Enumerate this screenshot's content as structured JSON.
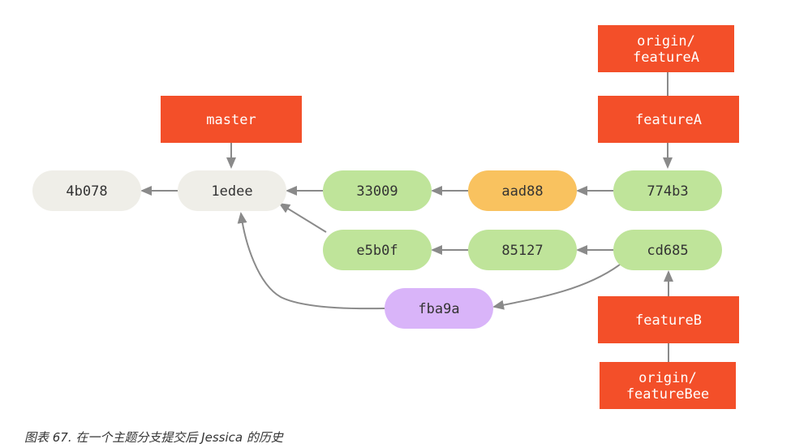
{
  "colors": {
    "branch": "#F34F29",
    "branch_text": "#ffffff",
    "commit_default": "#EFEEE8",
    "commit_green": "#BFE49A",
    "commit_orange": "#F9C25F",
    "commit_purple": "#D9B4F9",
    "commit_text": "#333333",
    "arrow": "#8A8A8A"
  },
  "commits": [
    {
      "id": "c-4b078",
      "label": "4b078",
      "color": "commit_default"
    },
    {
      "id": "c-1edee",
      "label": "1edee",
      "color": "commit_default"
    },
    {
      "id": "c-33009",
      "label": "33009",
      "color": "commit_green"
    },
    {
      "id": "c-aad88",
      "label": "aad88",
      "color": "commit_orange"
    },
    {
      "id": "c-774b3",
      "label": "774b3",
      "color": "commit_green"
    },
    {
      "id": "c-e5b0f",
      "label": "e5b0f",
      "color": "commit_green"
    },
    {
      "id": "c-85127",
      "label": "85127",
      "color": "commit_green"
    },
    {
      "id": "c-cd685",
      "label": "cd685",
      "color": "commit_green"
    },
    {
      "id": "c-fba9a",
      "label": "fba9a",
      "color": "commit_purple"
    }
  ],
  "branches": [
    {
      "id": "b-master",
      "lines": [
        "master"
      ]
    },
    {
      "id": "b-featureA",
      "lines": [
        "featureA"
      ]
    },
    {
      "id": "b-origin-featureA",
      "lines": [
        "origin/",
        "featureA"
      ]
    },
    {
      "id": "b-featureB",
      "lines": [
        "featureB"
      ]
    },
    {
      "id": "b-origin-featureBee",
      "lines": [
        "origin/",
        "featureBee"
      ]
    }
  ],
  "caption": "图表 67. 在一个主题分支提交后 Jessica 的历史"
}
